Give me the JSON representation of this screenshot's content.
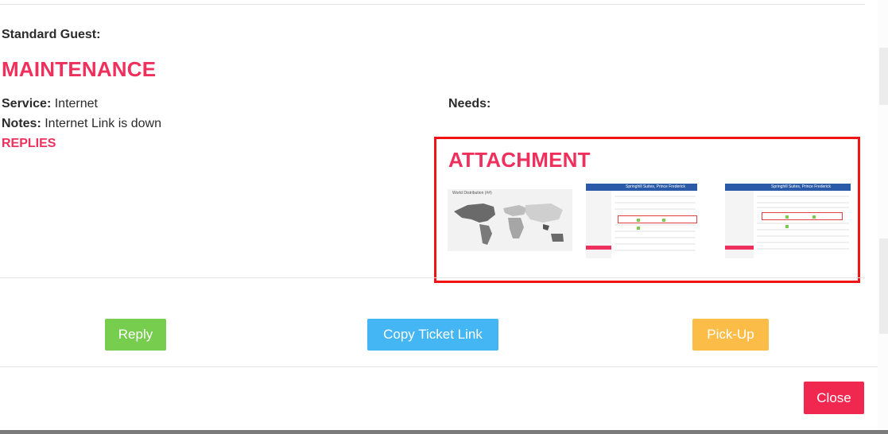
{
  "guest": {
    "label": "Standard Guest:"
  },
  "ticket": {
    "category": "MAINTENANCE",
    "service_label": "Service:",
    "service_value": "Internet",
    "notes_label": "Notes:",
    "notes_value": "Internet Link is down",
    "replies_link": "REPLIES",
    "needs_label": "Needs:"
  },
  "attachment": {
    "heading": "ATTACHMENT",
    "thumbnails": [
      {
        "name": "world-map-thumbnail",
        "title": "World Distribution (##)"
      },
      {
        "name": "dashboard-screenshot-thumbnail-1",
        "header": "Springhill Suites, Prince Frederick"
      },
      {
        "name": "dashboard-screenshot-thumbnail-2",
        "header": "Springhill Suites, Prince Frederick"
      }
    ]
  },
  "actions": {
    "reply": "Reply",
    "copy_link": "Copy Ticket Link",
    "pickup": "Pick-Up",
    "close": "Close"
  },
  "colors": {
    "accent_pink": "#ef2f5c",
    "reply_green": "#76cd4e",
    "copy_blue": "#45b6f4",
    "pickup_yellow": "#fbbd48",
    "close_red": "#f0274f",
    "attachment_border": "#f01414"
  }
}
